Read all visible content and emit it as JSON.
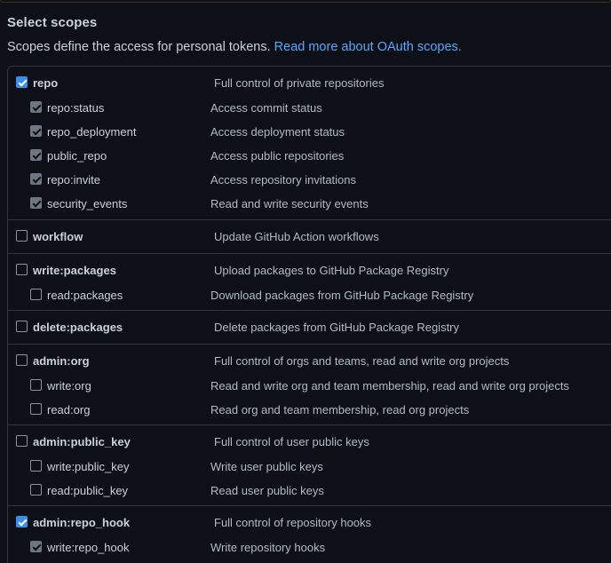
{
  "heading": "Select scopes",
  "description": "Scopes define the access for personal tokens.",
  "oauth_link": "Read more about OAuth scopes.",
  "colors": {
    "background": "#0d1117",
    "border": "#30363d",
    "link": "#58a6ff",
    "checkbox_checked": "#3b8eea",
    "checkbox_checked_inherited": "#6e7681"
  },
  "scopes": [
    {
      "name": "repo",
      "description": "Full control of private repositories",
      "checked": true,
      "children": [
        {
          "name": "repo:status",
          "description": "Access commit status",
          "checked": true
        },
        {
          "name": "repo_deployment",
          "description": "Access deployment status",
          "checked": true
        },
        {
          "name": "public_repo",
          "description": "Access public repositories",
          "checked": true
        },
        {
          "name": "repo:invite",
          "description": "Access repository invitations",
          "checked": true
        },
        {
          "name": "security_events",
          "description": "Read and write security events",
          "checked": true
        }
      ]
    },
    {
      "name": "workflow",
      "description": "Update GitHub Action workflows",
      "checked": false,
      "children": []
    },
    {
      "name": "write:packages",
      "description": "Upload packages to GitHub Package Registry",
      "checked": false,
      "children": [
        {
          "name": "read:packages",
          "description": "Download packages from GitHub Package Registry",
          "checked": false
        }
      ]
    },
    {
      "name": "delete:packages",
      "description": "Delete packages from GitHub Package Registry",
      "checked": false,
      "children": []
    },
    {
      "name": "admin:org",
      "description": "Full control of orgs and teams, read and write org projects",
      "checked": false,
      "children": [
        {
          "name": "write:org",
          "description": "Read and write org and team membership, read and write org projects",
          "checked": false
        },
        {
          "name": "read:org",
          "description": "Read org and team membership, read org projects",
          "checked": false
        }
      ]
    },
    {
      "name": "admin:public_key",
      "description": "Full control of user public keys",
      "checked": false,
      "children": [
        {
          "name": "write:public_key",
          "description": "Write user public keys",
          "checked": false
        },
        {
          "name": "read:public_key",
          "description": "Read user public keys",
          "checked": false
        }
      ]
    },
    {
      "name": "admin:repo_hook",
      "description": "Full control of repository hooks",
      "checked": true,
      "children": [
        {
          "name": "write:repo_hook",
          "description": "Write repository hooks",
          "checked": true
        }
      ]
    }
  ]
}
